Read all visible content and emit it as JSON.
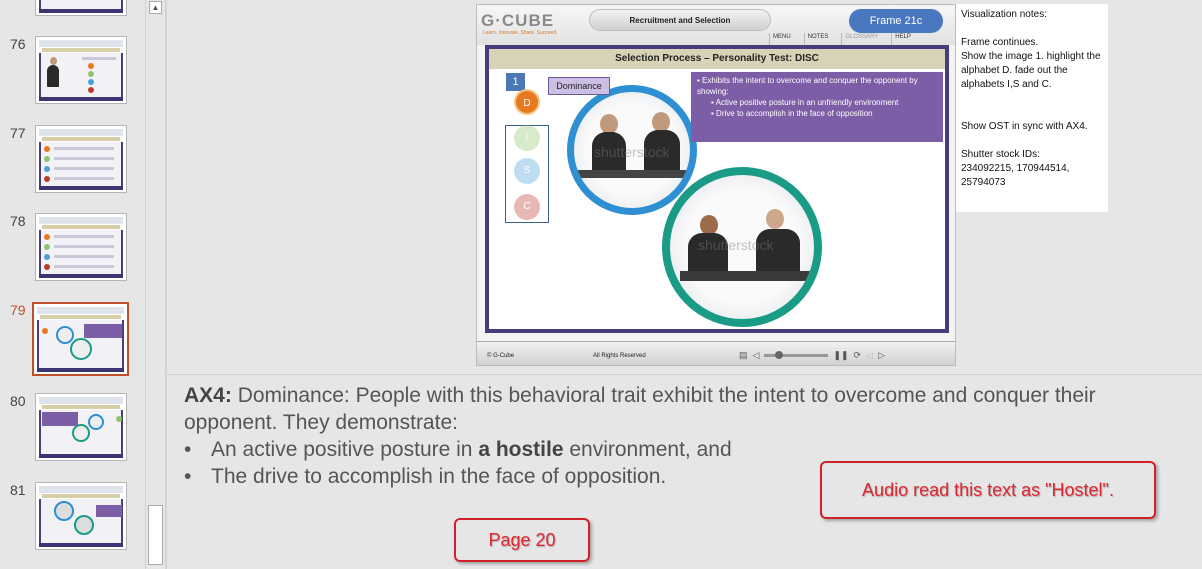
{
  "thumbnails": [
    {
      "number": "76",
      "active": false
    },
    {
      "number": "77",
      "active": false
    },
    {
      "number": "78",
      "active": false
    },
    {
      "number": "79",
      "active": true
    },
    {
      "number": "80",
      "active": false
    },
    {
      "number": "81",
      "active": false
    }
  ],
  "slide": {
    "logo": "G·CUBE",
    "logo_tagline": "Learn. Innovate. Share. Succeed.",
    "course_title": "Recruitment and Selection",
    "frame_label": "Frame 21c",
    "nav": [
      "MENU",
      "NOTES",
      "GLOSSARY",
      "HELP"
    ],
    "section_title": "Selection Process – Personality Test: DISC",
    "number_badge": "1",
    "letters": [
      "D",
      "I",
      "S",
      "C"
    ],
    "letter_colors": [
      "#e8791f",
      "#8fc56a",
      "#4aa0d8",
      "#c0392b"
    ],
    "dominance_label": "Dominance",
    "info_intro": "▪ Exhibits the intent to overcome and conquer the opponent by showing:",
    "info_points": [
      "▪ Active positive posture in an unfriendly environment",
      "▪ Drive to accomplish in the face of opposition"
    ],
    "watermark": "shutterstock",
    "footer_copyright": "© G-Cube",
    "footer_rights": "All Rights Reserved"
  },
  "visualization_notes": "Visualization notes:\n\nFrame continues.\nShow the image 1. highlight the alphabet D. fade out the alphabets I,S and C.\n\n\nShow OST in sync with AX4.\n\nShutter stock IDs:\n234092215, 170944514, 25794073",
  "notes": {
    "ax_label": "AX4:",
    "intro": " Dominance: People with this behavioral trait exhibit the intent to overcome and conquer their opponent. They demonstrate:",
    "bullet1_pre": "An active positive posture in ",
    "bullet1_bold": "a hostile",
    "bullet1_post": " environment, and",
    "bullet2": "The drive to accomplish in the face of opposition.",
    "bullet_char": "•"
  },
  "callouts": {
    "audio": "Audio read this text as \"Hostel\".",
    "page": "Page 20"
  },
  "colors": {
    "accent_active": "#c0502a",
    "callout_red": "#d0212a",
    "slide_frame": "#473c7d",
    "info_box": "#7b5ea5"
  }
}
